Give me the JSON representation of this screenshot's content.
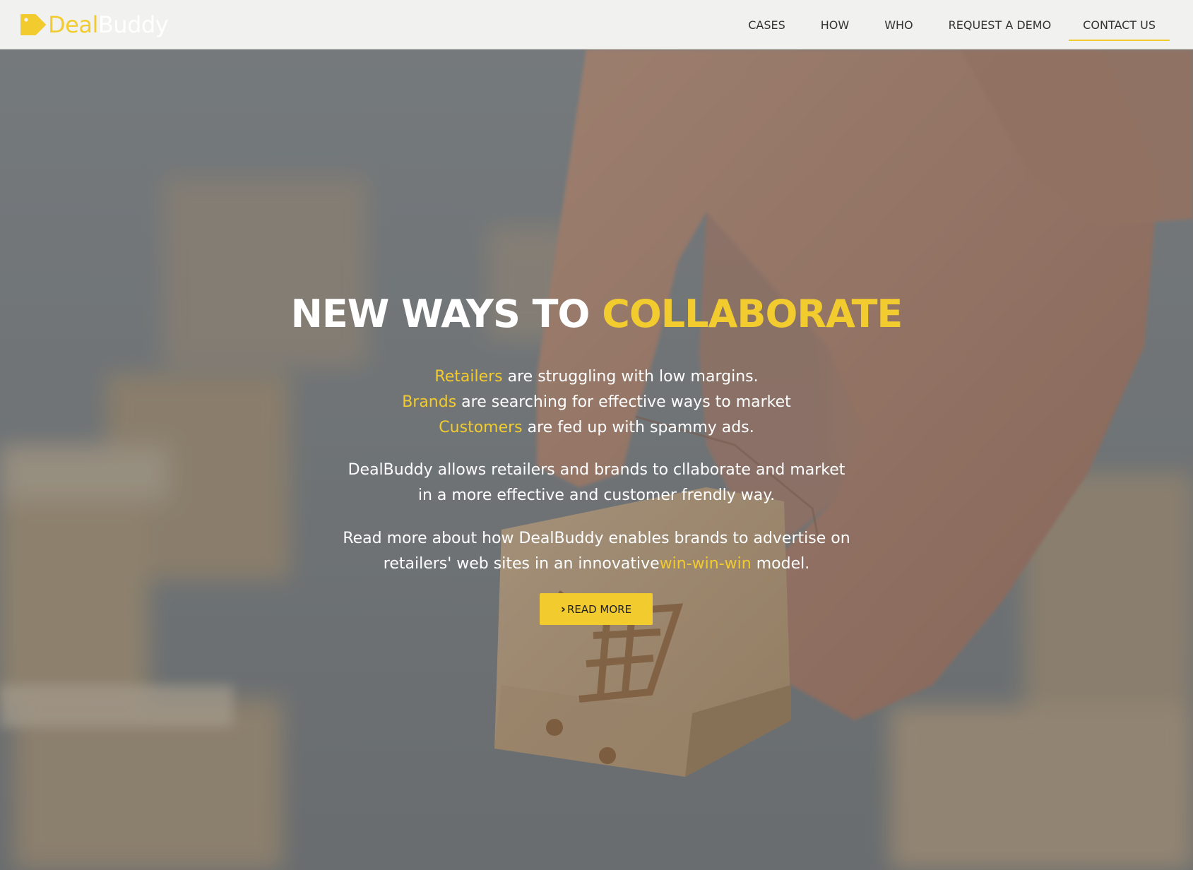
{
  "brand": {
    "name_part1": "Deal",
    "name_part2": "Buddy",
    "accent_color": "#f2cb2f",
    "logo_icon": "tag-icon"
  },
  "nav": {
    "items": [
      {
        "label": "CASES"
      },
      {
        "label": "HOW"
      },
      {
        "label": "WHO"
      },
      {
        "label": "REQUEST A DEMO"
      },
      {
        "label": "CONTACT US",
        "active": true
      }
    ]
  },
  "hero": {
    "headline_white": "NEW WAYS TO ",
    "headline_accent": "COLLABORATE",
    "lines": [
      {
        "accent": "Retailers",
        "rest": " are struggling with low margins."
      },
      {
        "accent": "Brands",
        "rest": " are searching for effective ways to market"
      },
      {
        "accent": "Customers",
        "rest": " are fed up with spammy ads."
      }
    ],
    "paragraph1_line1": "DealBuddy allows retailers and brands to cllaborate and market",
    "paragraph1_line2": "in a more effective and customer frendly way.",
    "paragraph2_line1": "Read more about how DealBuddy enables brands to advertise on",
    "paragraph2_line2_start": "retailers' web sites in an innovative",
    "paragraph2_line2_accent": "win-win-win",
    "paragraph2_line2_end": " model.",
    "cta_icon": "chevron-right-icon",
    "cta_label": "READ MORE",
    "background_image": "hand placing wooden block with shopping cart icon"
  }
}
